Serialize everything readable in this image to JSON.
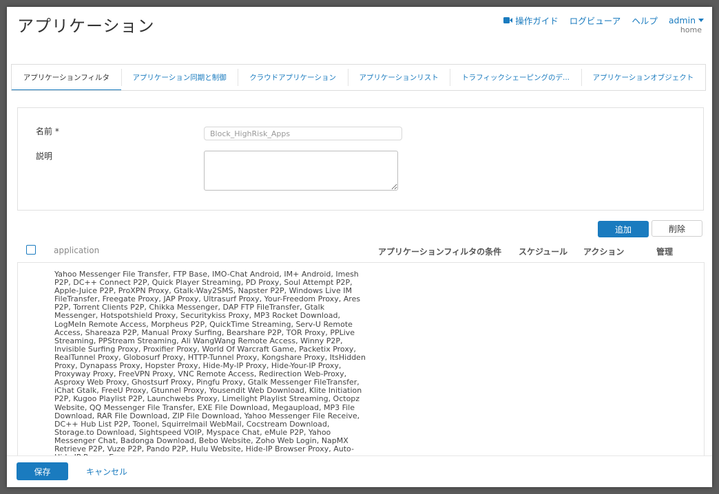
{
  "header": {
    "title": "アプリケーション",
    "guide_label": "操作ガイド",
    "log_viewer_label": "ログビューア",
    "help_label": "ヘルプ",
    "user_label": "admin",
    "breadcrumb": "home",
    "link_color": "#1a7bbf"
  },
  "tabs": [
    {
      "label": "アプリケーションフィルタ",
      "active": true
    },
    {
      "label": "アプリケーション同期と制御",
      "active": false
    },
    {
      "label": "クラウドアプリケーション",
      "active": false
    },
    {
      "label": "アプリケーションリスト",
      "active": false
    },
    {
      "label": "トラフィックシェーピングのデ...",
      "active": false
    },
    {
      "label": "アプリケーションオブジェクト",
      "active": false
    }
  ],
  "form": {
    "name_label": "名前 *",
    "name_value": "Block_HighRisk_Apps",
    "description_label": "説明",
    "description_value": ""
  },
  "actions": {
    "add_label": "追加",
    "delete_label": "削除"
  },
  "table": {
    "columns": {
      "application": "application",
      "filter_conditions": "アプリケーションフィルタの条件",
      "schedule": "スケジュール",
      "action": "アクション",
      "manage": "管理"
    },
    "rows": [
      {
        "application": "Yahoo Messenger File Transfer, FTP Base, IMO-Chat Android, IM+ Android, Imesh P2P, DC++ Connect P2P, Quick Player Streaming, PD Proxy, Soul Attempt P2P, Apple-Juice P2P, ProXPN Proxy, Gtalk-Way2SMS, Napster P2P, Windows Live IM FileTransfer, Freegate Proxy, JAP Proxy, Ultrasurf Proxy, Your-Freedom Proxy, Ares P2P, Torrent Clients P2P, Chikka Messenger, DAP FTP FileTransfer, Gtalk Messenger, Hotspotshield Proxy, Securitykiss Proxy, MP3 Rocket Download, LogMeIn Remote Access, Morpheus P2P, QuickTime Streaming, Serv-U Remote Access, Shareaza P2P, Manual Proxy Surfing, Bearshare P2P, TOR Proxy, PPLive Streaming, PPStream Streaming, Ali WangWang Remote Access, Winny P2P, Invisible Surfing Proxy, Proxifier Proxy, World Of Warcraft Game, Packetix Proxy, RealTunnel Proxy, Globosurf Proxy, HTTP-Tunnel Proxy, Kongshare Proxy, ItsHidden Proxy, Dynapass Proxy, Hopster Proxy, Hide-My-IP Proxy, Hide-Your-IP Proxy, Proxyway Proxy, FreeVPN Proxy, VNC Remote Access, Redirection Web-Proxy, Asproxy Web Proxy, Ghostsurf Proxy, Pingfu Proxy, Gtalk Messenger FileTransfer, iChat Gtalk, FreeU Proxy, Gtunnel Proxy, Yousendit Web Download, Klite Initiation P2P, Kugoo Playlist P2P, Launchwebs Proxy, Limelight Playlist Streaming, Octopz Website, QQ Messenger File Transfer, EXE File Download, Megaupload, MP3 File Download, RAR File Download, ZIP File Download, Yahoo Messenger File Receive, DC++ Hub List P2P, Toonel, Squirrelmail WebMail, Cocstream Download, Storage.to Download, Sightspeed VOIP, Myspace Chat, eMule P2P, Yahoo Messenger Chat, Badonga Download, Bebo Website, Zoho Web Login, NapMX Retrieve P2P, Vuze P2P, Pando P2P, Hulu Website, Hide-IP Browser Proxy, Auto-Hide IP Proxy, Easy-"
      }
    ]
  },
  "footer": {
    "save_label": "保存",
    "cancel_label": "キャンセル"
  }
}
